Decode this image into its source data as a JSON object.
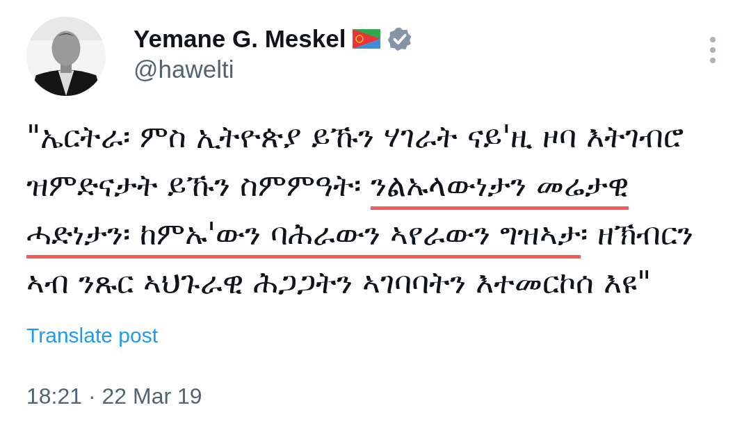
{
  "author": {
    "name": "Yemane G. Meskel",
    "handle": "@hawelti",
    "verified": true
  },
  "tweet": {
    "lines": [
      [
        {
          "text": "\"ኤርትራ፡ ምስ ኢትዮጵያ ይኹን ሃገራት ናይ'ዚ ዞባ እትገብሮ",
          "underlined": false
        }
      ],
      [
        {
          "text": "ዝምድናታት ይኹን ስምምዓት፡ ",
          "underlined": false
        },
        {
          "text": "ንልኡላውነታን መሬታዊ",
          "underlined": true
        }
      ],
      [
        {
          "text": "ሓድነታን፡ ከምኡ'ውን ባሕራውን ኣየራውን ግዝኣታ",
          "underlined": true
        },
        {
          "text": "፡ ዘኽብርን",
          "underlined": false
        }
      ],
      [
        {
          "text": "ኣብ ንጹር ኣህጉራዊ ሕጋጋትን ኣገባባትን እተመርኮሰ እዩ\"",
          "underlined": false
        }
      ]
    ],
    "translate_link": "Translate post",
    "timestamp": "18:21 · 22 Mar 19"
  }
}
